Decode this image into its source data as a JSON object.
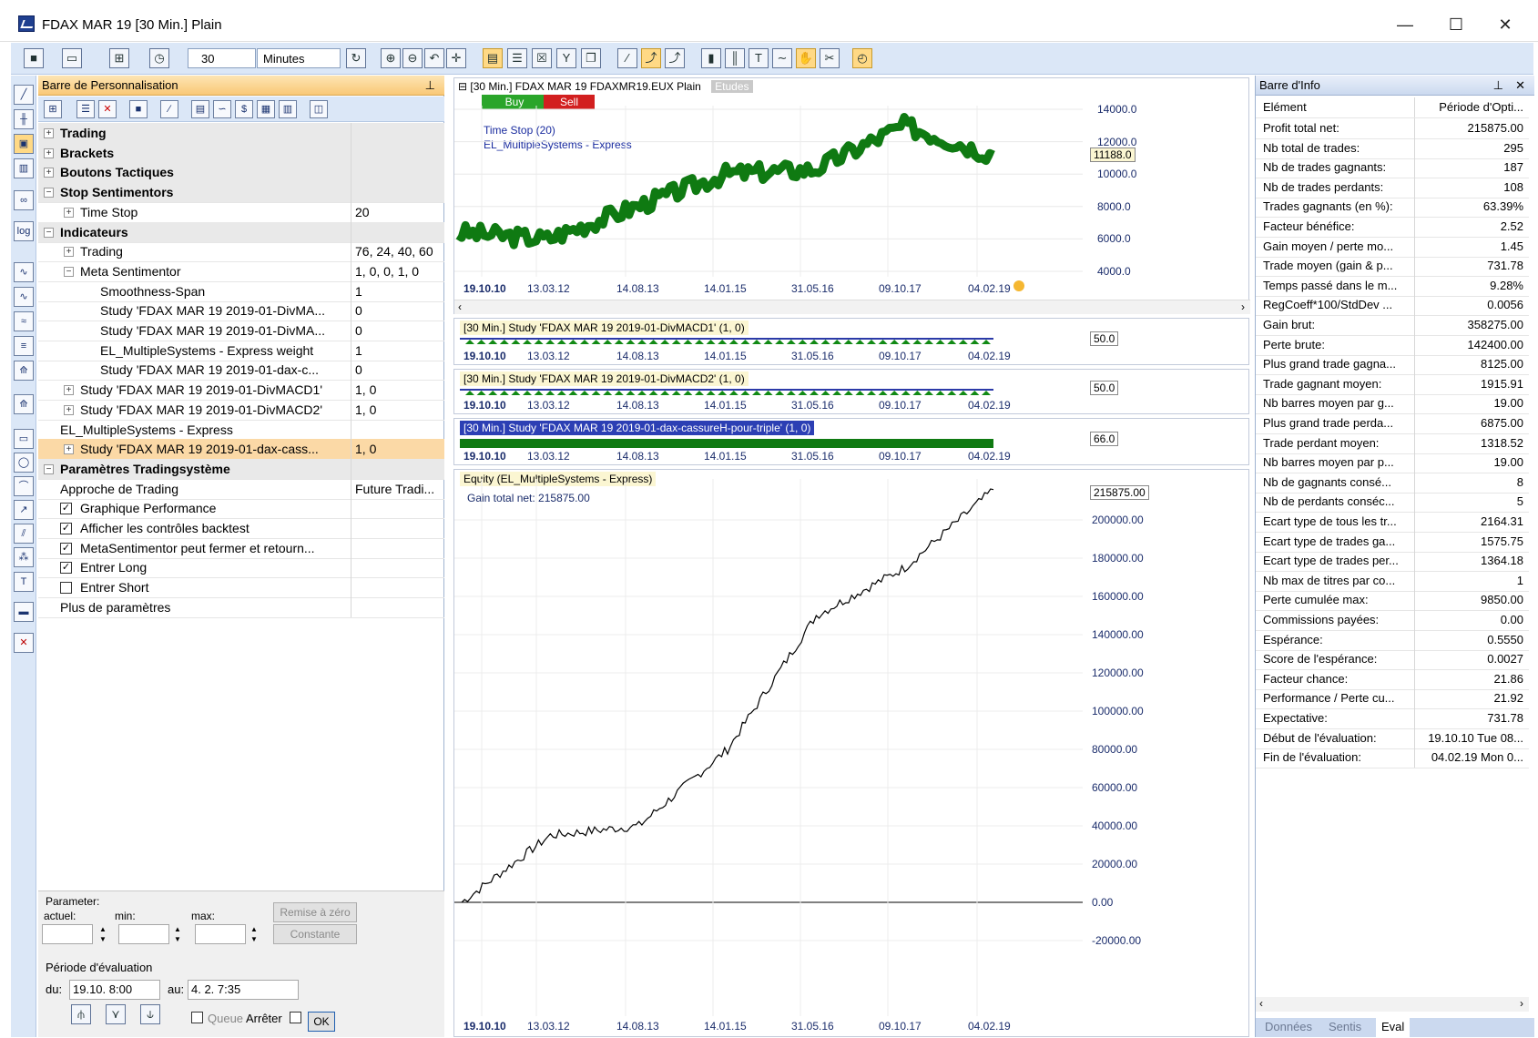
{
  "window": {
    "title": "FDAX MAR 19 [30 Min.]  Plain",
    "min": "—",
    "max": "☐",
    "close": "✕"
  },
  "toolbar": {
    "interval": "30",
    "unit": "Minutes"
  },
  "panel": {
    "title": "Barre de Personnalisation",
    "rows": [
      {
        "name": "Trading",
        "val": "",
        "type": "cat",
        "exp": "+"
      },
      {
        "name": "Brackets",
        "val": "",
        "type": "cat",
        "exp": "+"
      },
      {
        "name": "Boutons Tactiques",
        "val": "",
        "type": "cat",
        "exp": "+"
      },
      {
        "name": "Stop Sentimentors",
        "val": "",
        "type": "cat",
        "exp": "−"
      },
      {
        "name": "Time Stop",
        "val": "20",
        "type": "item",
        "exp": "+"
      },
      {
        "name": "Indicateurs",
        "val": "",
        "type": "cat",
        "exp": "−"
      },
      {
        "name": "Trading",
        "val": "76, 24, 40, 60",
        "type": "item",
        "exp": "+"
      },
      {
        "name": "Meta Sentimentor",
        "val": "1, 0, 0, 1, 0",
        "type": "item",
        "exp": "−"
      },
      {
        "name": "Smoothness-Span",
        "val": "1",
        "type": "sub"
      },
      {
        "name": "Study 'FDAX MAR 19  2019-01-DivMA...",
        "val": "0",
        "type": "sub"
      },
      {
        "name": "Study 'FDAX MAR 19  2019-01-DivMA...",
        "val": "0",
        "type": "sub"
      },
      {
        "name": "EL_MultipleSystems - Express weight",
        "val": "1",
        "type": "sub"
      },
      {
        "name": "Study 'FDAX MAR 19  2019-01-dax-c...",
        "val": "0",
        "type": "sub"
      },
      {
        "name": "Study 'FDAX MAR 19  2019-01-DivMACD1'",
        "val": "1, 0",
        "type": "item",
        "exp": "+"
      },
      {
        "name": "Study 'FDAX MAR 19  2019-01-DivMACD2'",
        "val": "1, 0",
        "type": "item",
        "exp": "+"
      },
      {
        "name": "EL_MultipleSystems - Express",
        "val": "",
        "type": "plain"
      },
      {
        "name": "Study 'FDAX MAR 19  2019-01-dax-cass...",
        "val": "1, 0",
        "type": "sel",
        "exp": "+"
      },
      {
        "name": "Paramètres Tradingsystème",
        "val": "",
        "type": "cat",
        "exp": "−"
      },
      {
        "name": "Approche de Trading",
        "val": "Future Tradi...",
        "type": "plain"
      },
      {
        "name": "Graphique Performance",
        "val": "",
        "type": "check",
        "checked": true
      },
      {
        "name": "Afficher les contrôles backtest",
        "val": "",
        "type": "check",
        "checked": true
      },
      {
        "name": "MetaSentimentor peut fermer et retourn...",
        "val": "",
        "type": "check",
        "checked": true
      },
      {
        "name": "Entrer Long",
        "val": "",
        "type": "check",
        "checked": true
      },
      {
        "name": "Entrer Short",
        "val": "",
        "type": "check",
        "checked": false
      },
      {
        "name": "Plus de paramètres",
        "val": "",
        "type": "plain"
      }
    ],
    "param": {
      "group": "Parameter:",
      "actuel": "actuel:",
      "min": "min:",
      "max": "max:",
      "reset": "Remise à zéro",
      "constant": "Constante",
      "period_label": "Période d'évaluation",
      "du": "du:",
      "from_value": "19.10.  8:00",
      "au": "au:",
      "to_value": "4.  2.  7:35",
      "queue": "Queue",
      "stop": "Arrêter",
      "ok": "OK"
    }
  },
  "chart": {
    "main_header": "[30 Min.] FDAX MAR 19   FDAXMR19.EUX Plain",
    "etudes": "Etudes",
    "buy": "Buy",
    "sell": "Sell",
    "time_stop": "Time Stop  (20)",
    "system": "EL_MultipleSystems - Express",
    "price_ticks": [
      "14000.0",
      "12000.0",
      "10000.0",
      "8000.0",
      "6000.0",
      "4000.0"
    ],
    "last_price": "11188.0",
    "x_labels": [
      "19.10.10",
      "13.03.12",
      "14.08.13",
      "14.01.15",
      "31.05.16",
      "09.10.17",
      "04.02.19"
    ],
    "macd1_header": "[30 Min.] Study 'FDAX MAR 19  2019-01-DivMACD1'  (1, 0)",
    "macd1_val": "50.0",
    "macd2_header": "[30 Min.] Study 'FDAX MAR 19  2019-01-DivMACD2'  (1, 0)",
    "macd2_val": "50.0",
    "dax_header": "[30 Min.] Study 'FDAX MAR 19  2019-01-dax-cassureH-pour-triple'  (1, 0)",
    "dax_val": "66.0",
    "equity_header": "Equity (EL_MultipleSystems - Express)",
    "gain": "Gain total net: 215875.00",
    "equity_last": "215875.00",
    "equity_ticks": [
      "200000.00",
      "180000.00",
      "160000.00",
      "140000.00",
      "120000.00",
      "100000.00",
      "80000.00",
      "60000.00",
      "40000.00",
      "20000.00",
      "0.00",
      "-20000.00"
    ]
  },
  "chart_data": {
    "type": "line",
    "series": [
      {
        "name": "FDAX MAR 19",
        "x": [
          "19.10.10",
          "13.03.12",
          "14.08.13",
          "14.01.15",
          "31.05.16",
          "09.10.17",
          "04.02.19"
        ],
        "values": [
          6400,
          6000,
          8000,
          10000,
          10300,
          13000,
          11188
        ]
      },
      {
        "name": "Equity (EL_MultipleSystems - Express)",
        "x": [
          "19.10.10",
          "13.03.12",
          "14.08.13",
          "14.01.15",
          "31.05.16",
          "09.10.17",
          "04.02.19"
        ],
        "values": [
          0,
          35000,
          40000,
          80000,
          150000,
          175000,
          215875
        ]
      }
    ]
  },
  "info": {
    "title": "Barre d'Info",
    "header": [
      "Elément",
      "Période d'Opti..."
    ],
    "rows": [
      [
        "Profit total net:",
        "215875.00"
      ],
      [
        "Nb total de trades:",
        "295"
      ],
      [
        "Nb de trades gagnants:",
        "187"
      ],
      [
        "Nb de trades perdants:",
        "108"
      ],
      [
        "Trades gagnants (en %):",
        "63.39%"
      ],
      [
        "Facteur bénéfice:",
        "2.52"
      ],
      [
        "Gain moyen / perte mo...",
        "1.45"
      ],
      [
        "Trade moyen (gain & p...",
        "731.78"
      ],
      [
        "Temps passé dans le m...",
        "9.28%"
      ],
      [
        "RegCoeff*100/StdDev ...",
        "0.0056"
      ],
      [
        "Gain brut:",
        "358275.00"
      ],
      [
        "Perte brute:",
        "142400.00"
      ],
      [
        "Plus grand trade gagna...",
        "8125.00"
      ],
      [
        "Trade gagnant moyen:",
        "1915.91"
      ],
      [
        "Nb barres moyen par g...",
        "19.00"
      ],
      [
        "Plus grand trade perda...",
        "6875.00"
      ],
      [
        "Trade perdant moyen:",
        "1318.52"
      ],
      [
        "Nb barres moyen par p...",
        "19.00"
      ],
      [
        "Nb de gagnants consé...",
        "8"
      ],
      [
        "Nb de perdants conséc...",
        "5"
      ],
      [
        "Ecart type de tous les tr...",
        "2164.31"
      ],
      [
        "Ecart type de trades ga...",
        "1575.75"
      ],
      [
        "Ecart type de trades per...",
        "1364.18"
      ],
      [
        "Nb max de titres par co...",
        "1"
      ],
      [
        "Perte cumulée max:",
        "9850.00"
      ],
      [
        "Commissions payées:",
        "0.00"
      ],
      [
        "Espérance:",
        "0.5550"
      ],
      [
        "Score de l'espérance:",
        "0.0027"
      ],
      [
        "Facteur chance:",
        "21.86"
      ],
      [
        "Performance / Perte cu...",
        "21.92"
      ],
      [
        "Expectative:",
        "731.78"
      ],
      [
        "Début de l'évaluation:",
        "19.10.10 Tue 08..."
      ],
      [
        "Fin de l'évaluation:",
        "04.02.19 Mon 0..."
      ]
    ],
    "tabs": [
      "Données",
      "Sentis",
      "Eval"
    ]
  }
}
